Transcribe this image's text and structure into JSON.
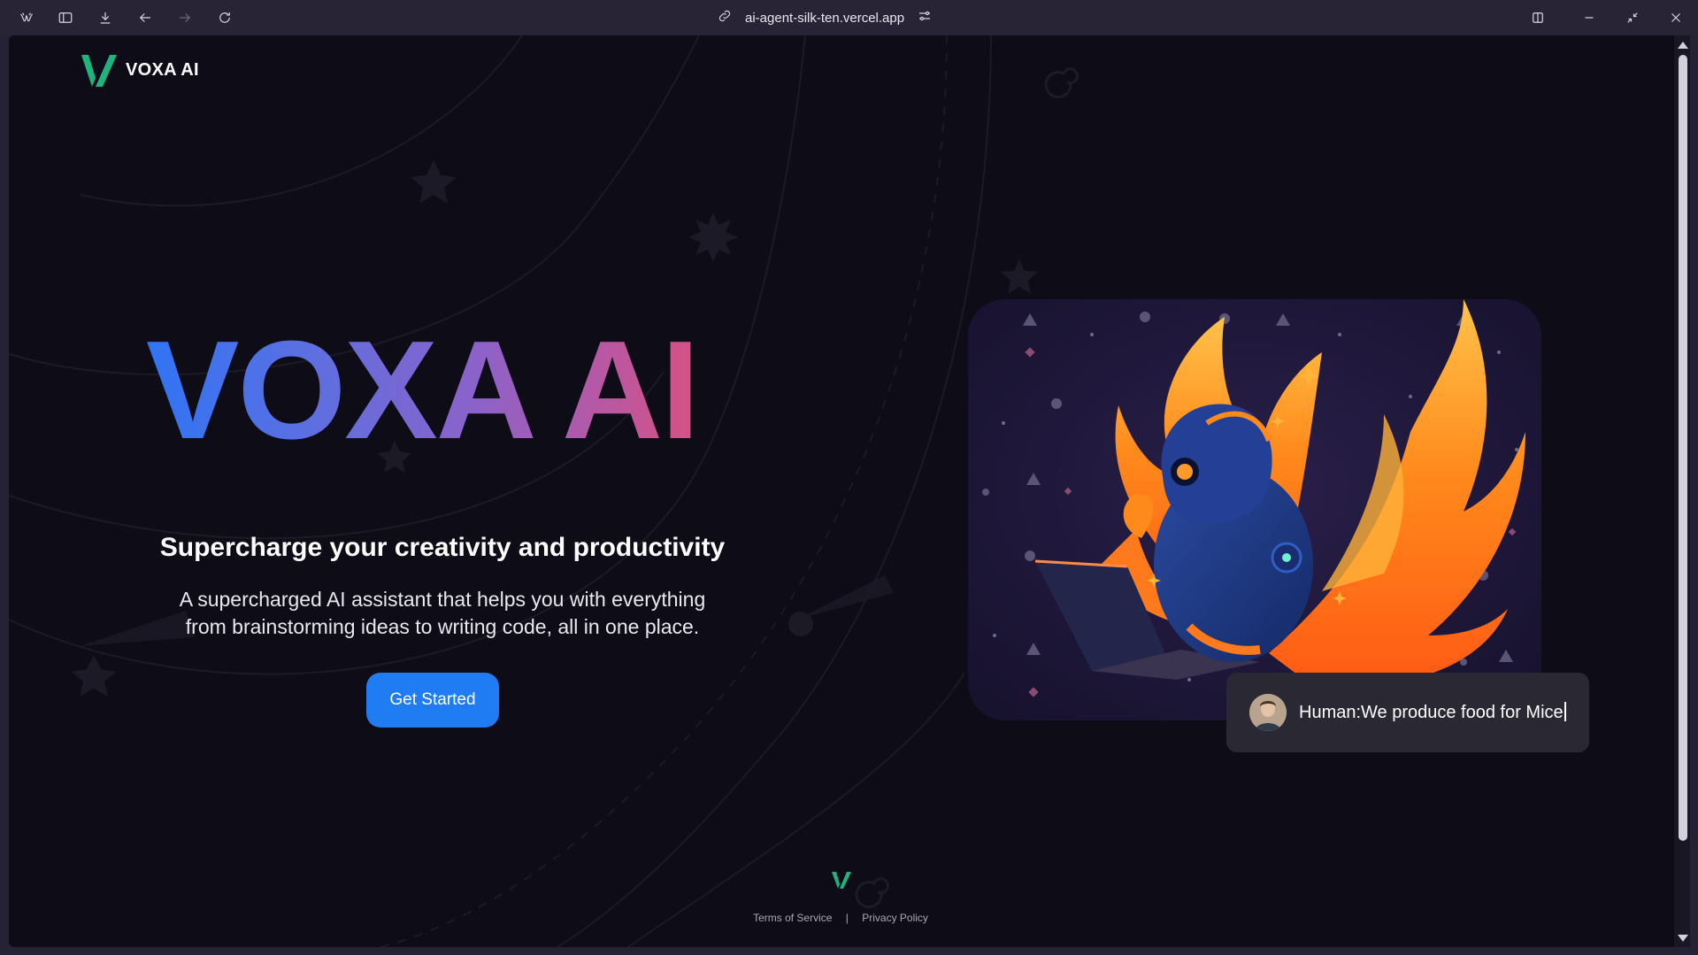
{
  "browser": {
    "url": "ai-agent-silk-ten.vercel.app",
    "icons": [
      "browser-logo-icon",
      "sidebar-icon",
      "download-icon",
      "back-icon",
      "forward-icon",
      "reload-icon",
      "link-icon",
      "site-settings-icon",
      "split-view-icon",
      "minimize-icon",
      "restore-icon",
      "close-icon"
    ]
  },
  "header": {
    "brand_name": "VOXA AI"
  },
  "hero": {
    "title": "VOXA AI",
    "subtitle": "Supercharge your creativity and productivity",
    "description": "A supercharged AI assistant that helps you with everything from brainstorming ideas to writing code, all in one place.",
    "cta_label": "Get Started"
  },
  "chat_bubble": {
    "text": "Human:We produce food for Mice"
  },
  "footer": {
    "terms": "Terms of Service",
    "separator": "|",
    "privacy": "Privacy Policy"
  },
  "colors": {
    "page_background": "#0e0c16",
    "brand_green": "#1fb37e",
    "cta_blue": "#1f7cf2",
    "gradient": [
      "#2f74f5",
      "#8c62c9",
      "#e34f74"
    ]
  }
}
